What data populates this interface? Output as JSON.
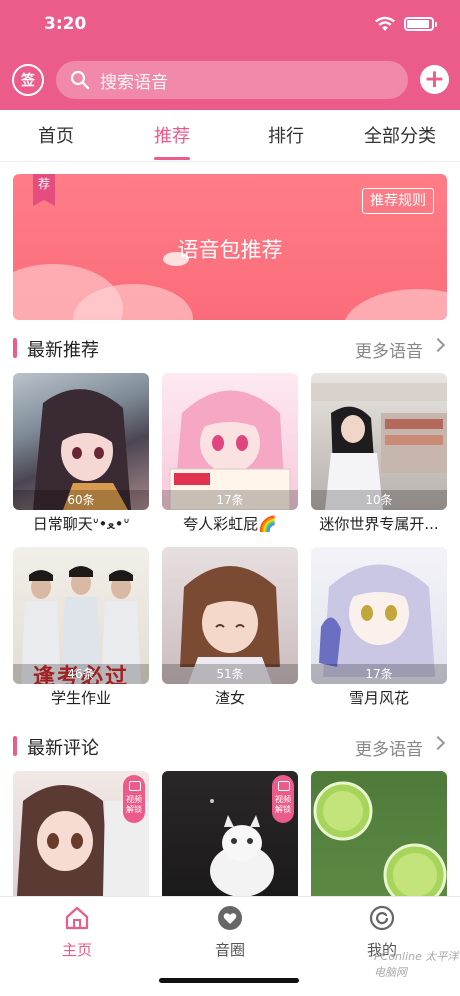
{
  "status": {
    "time": "3:20"
  },
  "header": {
    "sign_label": "签",
    "search_placeholder": "搜索语音",
    "add_label": "+"
  },
  "tabs": [
    {
      "label": "首页"
    },
    {
      "label": "推荐"
    },
    {
      "label": "排行"
    },
    {
      "label": "全部分类"
    }
  ],
  "active_tab": "推荐",
  "banner": {
    "tag": "荐",
    "title": "语音包推荐",
    "rule_button": "推荐规则"
  },
  "latest_recommend": {
    "title": "最新推荐",
    "more": "更多语音",
    "items": [
      {
        "title": "日常聊天ᐡ•ﻌ•ᐡ",
        "count": "60条"
      },
      {
        "title": "夸人彩虹屁🌈",
        "count": "17条"
      },
      {
        "title": "迷你世界专属开...",
        "count": "10条"
      },
      {
        "title": "学生作业",
        "count": "46条",
        "overlay_text": "逢考必过"
      },
      {
        "title": "渣女",
        "count": "51条"
      },
      {
        "title": "雪月风花",
        "count": "17条"
      }
    ]
  },
  "latest_comments": {
    "title": "最新评论",
    "more": "更多语音",
    "lock_badge": "视频解锁",
    "items": [
      {
        "locked": true
      },
      {
        "locked": true
      },
      {
        "locked": false
      }
    ]
  },
  "bottom_nav": [
    {
      "label": "主页"
    },
    {
      "label": "音圈"
    },
    {
      "label": "我的"
    }
  ],
  "active_nav": "主页",
  "watermark": "PConline 太平洋电脑网",
  "colors": {
    "accent": "#ec5c8b",
    "banner": "#fb6c7a"
  }
}
